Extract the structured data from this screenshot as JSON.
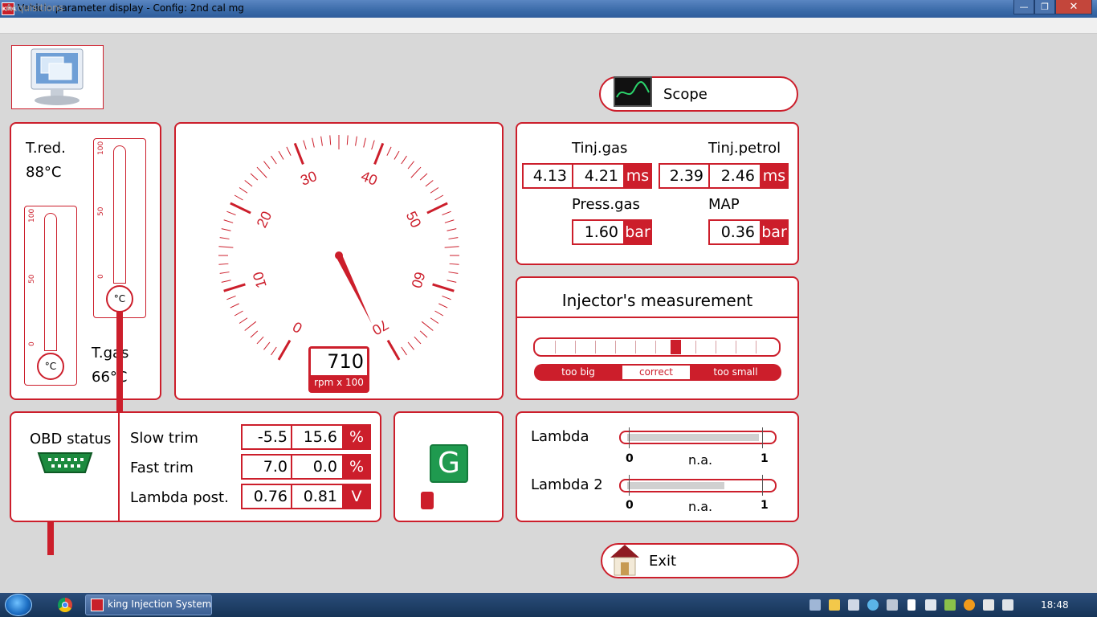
{
  "window": {
    "title": "Vehicle parameter display - Config: 2nd cal mg",
    "icon_text": "KING",
    "min_glyph": "—",
    "max_glyph": "❐",
    "close_glyph": "✕"
  },
  "menu": {
    "acquisitions": "Acquisitions"
  },
  "buttons": {
    "scope": "Scope",
    "exit": "Exit"
  },
  "temps": {
    "t_red_label": "T.red.",
    "t_red_value": "88°C",
    "t_gas_label": "T.gas",
    "t_gas_value": "66°C",
    "unit": "°C",
    "ticks": [
      "100",
      "50",
      "0"
    ],
    "t_red_level": 0.85,
    "t_gas_level": 0.63
  },
  "rpm": {
    "value": "710",
    "unit": "rpm x 100",
    "scale_labels": [
      "0",
      "10",
      "20",
      "30",
      "40",
      "50",
      "60",
      "70"
    ],
    "needle": 7.1
  },
  "injection": {
    "tinj_gas_label": "Tinj.gas",
    "tinj_gas_1": "4.13",
    "tinj_gas_2": "4.21",
    "tinj_gas_unit": "ms",
    "tinj_petrol_label": "Tinj.petrol",
    "tinj_petrol_1": "2.39",
    "tinj_petrol_2": "2.46",
    "tinj_petrol_unit": "ms",
    "press_gas_label": "Press.gas",
    "press_gas_value": "1.60",
    "press_gas_unit": "bar",
    "map_label": "MAP",
    "map_value": "0.36",
    "map_unit": "bar"
  },
  "injector_measurement": {
    "title": "Injector's measurement",
    "too_big": "too big",
    "correct": "correct",
    "too_small": "too small",
    "indicator_position": 0.58
  },
  "obd": {
    "status_label": "OBD status",
    "rows": [
      {
        "label": "Slow trim",
        "v1": "-5.5",
        "v2": "15.6",
        "unit": "%"
      },
      {
        "label": "Fast trim",
        "v1": "7.0",
        "v2": "0.0",
        "unit": "%"
      },
      {
        "label": "Lambda post.",
        "v1": "0.76",
        "v2": "0.81",
        "unit": "V"
      }
    ]
  },
  "fuel": {
    "indicator": "G"
  },
  "lambda": {
    "l1_label": "Lambda",
    "l1_min": "0",
    "l1_text": "n.a.",
    "l1_max": "1",
    "l1_fill": 0.92,
    "l2_label": "Lambda 2",
    "l2_min": "0",
    "l2_text": "n.a.",
    "l2_max": "1",
    "l2_fill": 0.68
  },
  "taskbar": {
    "app_label": "king Injection System",
    "clock": "18:48"
  }
}
